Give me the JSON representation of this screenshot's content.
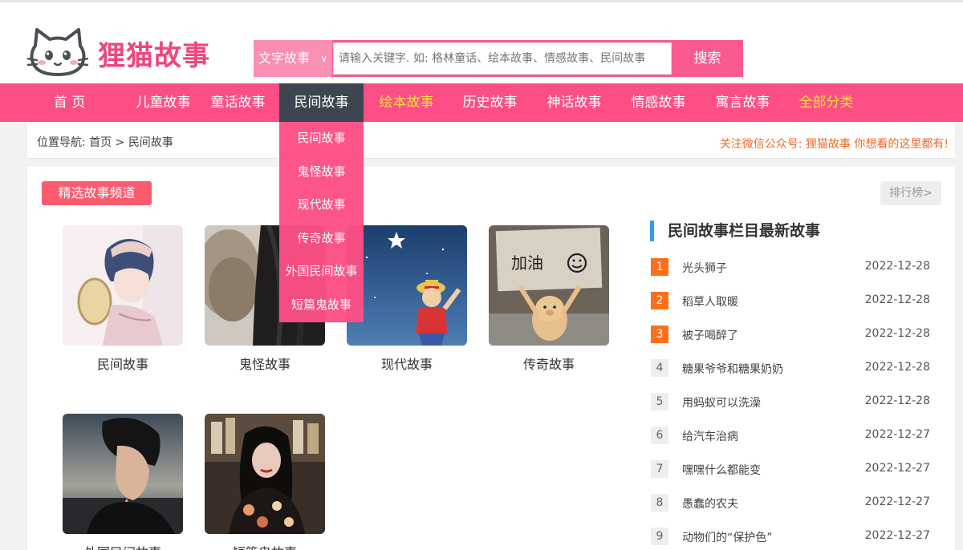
{
  "site": {
    "name": "狸猫故事"
  },
  "search": {
    "type_label": "文字故事",
    "placeholder": "请输入关键字. 如: 格林童话、绘本故事、情感故事、民间故事",
    "button_label": "搜索"
  },
  "nav": {
    "items": [
      "首 页",
      "儿童故事",
      "童话故事",
      "民间故事",
      "绘本故事",
      "历史故事",
      "神话故事",
      "情感故事",
      "寓言故事",
      "全部分类"
    ],
    "active": "民间故事",
    "highlighted": [
      "绘本故事",
      "全部分类"
    ],
    "highlight_color": "#ffe23f",
    "bar_color": "#fd4f86",
    "active_color": "#3d4650"
  },
  "dropdown": {
    "items": [
      "民间故事",
      "鬼怪故事",
      "现代故事",
      "传奇故事",
      "外国民间故事",
      "短篇鬼故事"
    ]
  },
  "breadcrumb": {
    "prefix": "位置导航:",
    "home": "首页",
    "separator": ">",
    "current": "民间故事"
  },
  "wechat_notice": "关注微信公众号: 狸猫故事 你想看的这里都有!",
  "channels": {
    "badge": "精选故事频道",
    "rank_button": "排行榜>",
    "cards": [
      "民间故事",
      "鬼怪故事",
      "现代故事",
      "传奇故事",
      "外国民间故事",
      "短篇鬼故事"
    ],
    "card4_sign_text": "加油"
  },
  "latest": {
    "title": "民间故事栏目最新故事",
    "items": [
      {
        "rank": "1",
        "title": "光头狮子",
        "date": "2022-12-28"
      },
      {
        "rank": "2",
        "title": "稻草人取暖",
        "date": "2022-12-28"
      },
      {
        "rank": "3",
        "title": "被子喝醉了",
        "date": "2022-12-28"
      },
      {
        "rank": "4",
        "title": "糖果爷爷和糖果奶奶",
        "date": "2022-12-28"
      },
      {
        "rank": "5",
        "title": "用蚂蚁可以洗澡",
        "date": "2022-12-28"
      },
      {
        "rank": "6",
        "title": "给汽车治病",
        "date": "2022-12-27"
      },
      {
        "rank": "7",
        "title": "嘿嘿什么都能变",
        "date": "2022-12-27"
      },
      {
        "rank": "8",
        "title": "愚蠢的农夫",
        "date": "2022-12-27"
      },
      {
        "rank": "9",
        "title": "动物们的“保护色”",
        "date": "2022-12-27"
      }
    ]
  }
}
